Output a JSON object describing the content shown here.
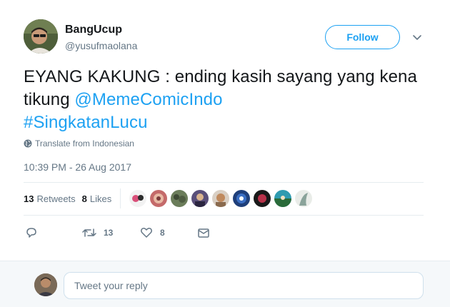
{
  "author": {
    "name": "BangUcup",
    "handle": "@yusufmaolana"
  },
  "follow_button": {
    "label": "Follow"
  },
  "tweet": {
    "text_main": "EYANG KAKUNG : ending kasih sayang yang kena tikung ",
    "mention": "@MemeComicIndo",
    "hashtag": "#SingkatanLucu",
    "translate_label": "Translate from Indonesian",
    "timestamp": "10:39 PM - 26 Aug 2017"
  },
  "stats": {
    "retweets_count": "13",
    "retweets_label": "Retweets",
    "likes_count": "8",
    "likes_label": "Likes"
  },
  "actions": {
    "retweet_count": "13",
    "like_count": "8"
  },
  "reply": {
    "placeholder": "Tweet your reply"
  },
  "colors": {
    "accent": "#1da1f2",
    "text": "#14171a",
    "muted": "#657786",
    "divider": "#e6ecf0",
    "reply_bg": "#f5f8fa"
  },
  "icons": [
    "globe-icon",
    "chevron-down-icon",
    "reply-icon",
    "retweet-icon",
    "heart-icon",
    "message-icon"
  ]
}
